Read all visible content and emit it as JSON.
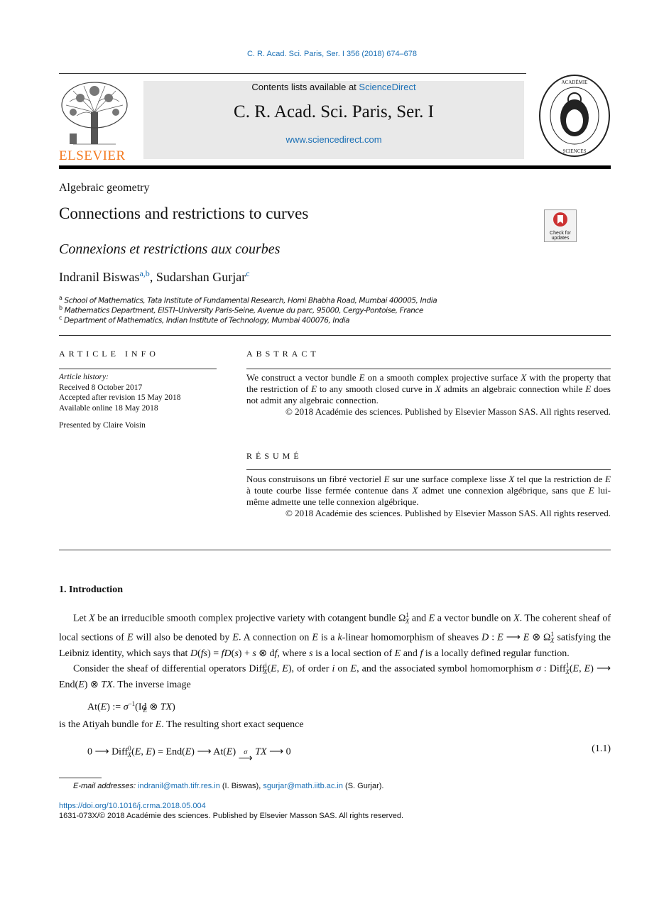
{
  "header": {
    "journal_ref": "C. R. Acad. Sci. Paris, Ser. I 356 (2018) 674–678",
    "contents_prefix": "Contents lists available at ",
    "contents_link": "ScienceDirect",
    "journal_title": "C. R. Acad. Sci. Paris, Ser. I",
    "journal_url": "www.sciencedirect.com",
    "publisher_logo": "ELSEVIER",
    "seal_text": "INSTITUT DE FRANCE · ACADÉMIE DES SCIENCES · 1666"
  },
  "article": {
    "section": "Algebraic geometry",
    "title": "Connections and restrictions to curves",
    "title_fr": "Connexions et restrictions aux courbes",
    "check_updates": "Check for updates",
    "authors": [
      {
        "name": "Indranil Biswas",
        "sup": "a,b"
      },
      {
        "name": "Sudarshan Gurjar",
        "sup": "c"
      }
    ],
    "author_sep": ", ",
    "affiliations": [
      {
        "sup": "a",
        "text": "School of Mathematics, Tata Institute of Fundamental Research, Homi Bhabha Road, Mumbai 400005, India"
      },
      {
        "sup": "b",
        "text": "Mathematics Department, EISTI–University Paris-Seine, Avenue du parc, 95000, Cergy-Pontoise, France"
      },
      {
        "sup": "c",
        "text": "Department of Mathematics, Indian Institute of Technology, Mumbai 400076, India"
      }
    ]
  },
  "info": {
    "heading": "ARTICLE INFO",
    "history_label": "Article history:",
    "received": "Received 8 October 2017",
    "accepted": "Accepted after revision 15 May 2018",
    "online": "Available online 18 May 2018",
    "presented": "Presented by Claire Voisin"
  },
  "abstract": {
    "heading": "ABSTRACT",
    "text": [
      [
        "We construct a vector bundle ",
        ""
      ],
      [
        "E",
        "i"
      ],
      [
        " on a smooth complex projective surface ",
        ""
      ],
      [
        "X",
        "i"
      ],
      [
        " with the property that the restriction of ",
        ""
      ],
      [
        "E",
        "i"
      ],
      [
        " to any smooth closed curve in ",
        ""
      ],
      [
        "X",
        "i"
      ],
      [
        " admits an algebraic connection while ",
        ""
      ],
      [
        "E",
        "i"
      ],
      [
        " does not admit any algebraic connection.",
        ""
      ]
    ],
    "copyright": "© 2018 Académie des sciences. Published by Elsevier Masson SAS. All rights reserved."
  },
  "resume": {
    "heading": "RÉSUMÉ",
    "text": [
      [
        "Nous construisons un fibré vectoriel ",
        ""
      ],
      [
        "E",
        "i"
      ],
      [
        " sur une surface complexe lisse ",
        ""
      ],
      [
        "X",
        "i"
      ],
      [
        " tel que la restriction de ",
        ""
      ],
      [
        "E",
        "i"
      ],
      [
        " à toute courbe lisse fermée contenue dans ",
        ""
      ],
      [
        "X",
        "i"
      ],
      [
        " admet une connexion algébrique, sans que ",
        ""
      ],
      [
        "E",
        "i"
      ],
      [
        " lui-même admette une telle connexion algébrique.",
        ""
      ]
    ],
    "copyright": "© 2018 Académie des sciences. Published by Elsevier Masson SAS. All rights reserved."
  },
  "intro": {
    "heading": "1. Introduction",
    "p1": [
      [
        "Let ",
        ""
      ],
      [
        "X",
        "i"
      ],
      [
        " be an irreducible smooth complex projective variety with cotangent bundle Ω",
        ""
      ],
      [
        "1",
        "sup"
      ],
      [
        "X",
        "subi"
      ],
      [
        " and ",
        ""
      ],
      [
        "E",
        "i"
      ],
      [
        " a vector bundle on ",
        ""
      ],
      [
        "X",
        "i"
      ],
      [
        ". The coherent sheaf of local sections of ",
        ""
      ],
      [
        "E",
        "i"
      ],
      [
        " will also be denoted by ",
        ""
      ],
      [
        "E",
        "i"
      ],
      [
        ". A connection on ",
        ""
      ],
      [
        "E",
        "i"
      ],
      [
        " is a ",
        ""
      ],
      [
        "k",
        "i"
      ],
      [
        "-linear homomorphism of sheaves ",
        ""
      ],
      [
        "D",
        "i"
      ],
      [
        " : ",
        ""
      ],
      [
        "E",
        "i"
      ],
      [
        " ⟶ ",
        ""
      ],
      [
        "E",
        "i"
      ],
      [
        " ⊗ Ω",
        ""
      ],
      [
        "1",
        "sup"
      ],
      [
        "X",
        "subi"
      ],
      [
        " satisfying the Leibniz identity, which says that ",
        ""
      ],
      [
        "D",
        "i"
      ],
      [
        "(",
        ""
      ],
      [
        "fs",
        "i"
      ],
      [
        ") = ",
        ""
      ],
      [
        "fD",
        "i"
      ],
      [
        "(",
        ""
      ],
      [
        "s",
        "i"
      ],
      [
        ") + ",
        ""
      ],
      [
        "s",
        "i"
      ],
      [
        " ⊗ d",
        ""
      ],
      [
        "f",
        "i"
      ],
      [
        ", where ",
        ""
      ],
      [
        "s",
        "i"
      ],
      [
        " is a local section of ",
        ""
      ],
      [
        "E",
        "i"
      ],
      [
        " and ",
        ""
      ],
      [
        "f",
        "i"
      ],
      [
        " is a locally defined regular function.",
        ""
      ]
    ],
    "p2": [
      [
        "Consider the sheaf of differential operators Diff",
        ""
      ],
      [
        "i",
        "sup"
      ],
      [
        "X",
        "subi"
      ],
      [
        "(",
        ""
      ],
      [
        "E",
        "i"
      ],
      [
        ", ",
        ""
      ],
      [
        "E",
        "i"
      ],
      [
        "), of order ",
        ""
      ],
      [
        "i",
        "i"
      ],
      [
        " on ",
        ""
      ],
      [
        "E",
        "i"
      ],
      [
        ", and the associated symbol homomorphism ",
        ""
      ],
      [
        "σ",
        "i"
      ],
      [
        " : Diff",
        ""
      ],
      [
        "1",
        "sup"
      ],
      [
        "X",
        "subi"
      ],
      [
        "(",
        ""
      ],
      [
        "E",
        "i"
      ],
      [
        ", ",
        ""
      ],
      [
        "E",
        "i"
      ],
      [
        ") ⟶ End(",
        ""
      ],
      [
        "E",
        "i"
      ],
      [
        ") ⊗ ",
        ""
      ],
      [
        "TX",
        "i"
      ],
      [
        ". The inverse image",
        ""
      ]
    ],
    "eq1": [
      [
        "At(",
        ""
      ],
      [
        "E",
        "i"
      ],
      [
        ") := ",
        ""
      ],
      [
        "σ",
        "i"
      ],
      [
        "−1",
        "sup"
      ],
      [
        "(Id",
        ""
      ],
      [
        "E",
        "subi"
      ],
      [
        " ⊗ ",
        ""
      ],
      [
        "TX",
        "i"
      ],
      [
        ")",
        ""
      ]
    ],
    "p3": [
      [
        "is the Atiyah bundle for ",
        ""
      ],
      [
        "E",
        "i"
      ],
      [
        ". The resulting short exact sequence",
        ""
      ]
    ],
    "eq2": [
      [
        "0 ⟶ Diff",
        ""
      ],
      [
        "0",
        "sup"
      ],
      [
        "X",
        "subi"
      ],
      [
        "(",
        ""
      ],
      [
        "E",
        "i"
      ],
      [
        ", ",
        ""
      ],
      [
        "E",
        "i"
      ],
      [
        ") = End(",
        ""
      ],
      [
        "E",
        "i"
      ],
      [
        ") ⟶ At(",
        ""
      ],
      [
        "E",
        "i"
      ],
      [
        ") ",
        ""
      ],
      [
        "σ",
        "over"
      ],
      [
        " ",
        ""
      ],
      [
        "TX",
        "i"
      ],
      [
        " ⟶ 0",
        ""
      ]
    ],
    "eq2_num": "(1.1)"
  },
  "footer": {
    "email_label": "E-mail addresses:",
    "email1": "indranil@math.tifr.res.in",
    "email1_who": " (I. Biswas), ",
    "email2": "sgurjar@math.iitb.ac.in",
    "email2_who": " (S. Gurjar).",
    "doi": "https://doi.org/10.1016/j.crma.2018.05.004",
    "issn": "1631-073X/© 2018 Académie des sciences. Published by Elsevier Masson SAS. All rights reserved."
  }
}
